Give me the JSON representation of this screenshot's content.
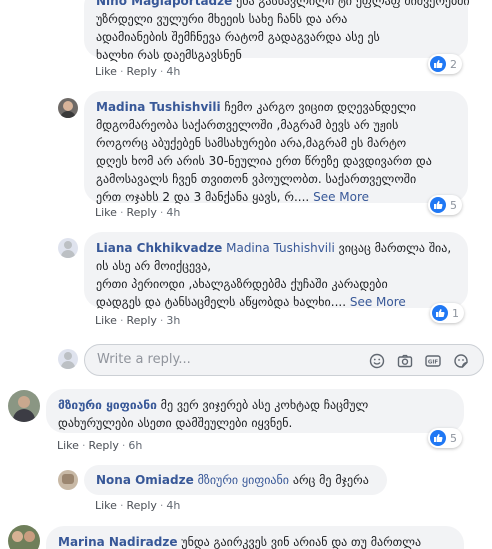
{
  "comments": [
    {
      "author": "Nino Magiaportadze",
      "mention": "",
      "lines": [
        "ენა გასწავლილი ტი ეფლაფ მიშვერებში",
        "უზრდელი ვულური მხეეის სახე ჩანს და არა",
        "ადამიანების შემჩნევა რატომ გადაგვარდა ასე ეს",
        "ხალხი რას დაემსგავსნენ"
      ],
      "see_more": "",
      "like": "Like",
      "reply": "Reply",
      "time": "4h",
      "reactions": "2"
    },
    {
      "author": "Madina Tushishvili",
      "mention": "",
      "lines": [
        "ჩემო კარგო ვიცით დღევანდელი",
        "მდგომარეობა საქართველოში ,მაგრამ ბევს არ უჟის",
        "როგორც აბუქებენ სამსახურები არა,მაგრამ ეს მარტო",
        "დღეს ხომ არ არის 30-ნეულია ერთ წრეზე დავდივართ და",
        "გამოსავალს ჩვენ თვითონ ვპოულობთ. საქართველოში",
        "ერთ ოჯახს 2 და 3 მანქანა ყავს, რ...."
      ],
      "see_more": "See More",
      "like": "Like",
      "reply": "Reply",
      "time": "4h",
      "reactions": "5"
    },
    {
      "author": "Liana Chkhikvadze",
      "mention": "Madina Tushishvili",
      "lines": [
        "ვიცაც მართლა შია,",
        "ის ასე არ მოიქცევა,",
        "ერთი პერიოდი ,ახალგაზრდებმა ქუჩაში კარადები",
        "დადგეს და ტანსაცმელს აწყობდა ხალხი...."
      ],
      "see_more": "See More",
      "like": "Like",
      "reply": "Reply",
      "time": "3h",
      "reactions": "1"
    },
    {
      "author": "მზიური ყიფიანი",
      "mention": "",
      "lines": [
        "მე ვერ ვიჯერებ ასე კოხტად ჩაცმულ",
        "დახურულები ასეთი დამშეულები იყვნენ."
      ],
      "see_more": "",
      "like": "Like",
      "reply": "Reply",
      "time": "6h",
      "reactions": "5"
    },
    {
      "author": "Nona Omiadze",
      "mention": "მზიური ყიფიანი",
      "lines": [
        "არც მე მჯერა"
      ],
      "see_more": "",
      "like": "Like",
      "reply": "Reply",
      "time": "4h",
      "reactions": ""
    },
    {
      "author": "Marina Nadiradze",
      "mention": "",
      "lines": [
        "უნდა გაირკვეს ვინ არიან და თუ მართლა"
      ],
      "see_more": "",
      "like": "",
      "reply": "",
      "time": "",
      "reactions": ""
    }
  ],
  "reply_box": {
    "placeholder": "Write a reply..."
  },
  "icons": [
    "smiley-icon",
    "camera-icon",
    "gif-icon",
    "sticker-icon"
  ],
  "colors": {
    "link": "#385898",
    "bubble": "#f2f3f5",
    "like_blue": "#2078f4",
    "meta": "#606770"
  }
}
